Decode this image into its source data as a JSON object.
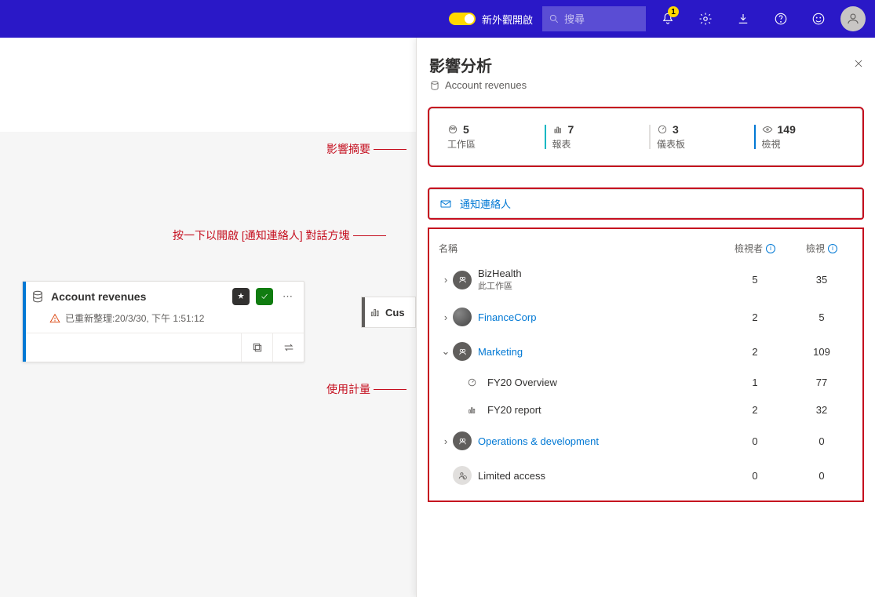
{
  "topnav": {
    "toggle_label": "新外觀開啟",
    "search_placeholder": "搜尋",
    "notification_count": "1"
  },
  "canvas": {
    "node1": {
      "title": "Account revenues",
      "refreshed": "已重新整理:20/3/30, 下午 1:51:12"
    },
    "node2_label": "Cus"
  },
  "callouts": {
    "summary": "影響摘要",
    "notify": "按一下以開啟 [通知連絡人] 對話方塊",
    "usage": "使用計量"
  },
  "panel": {
    "title": "影響分析",
    "subtitle": "Account revenues",
    "summary": [
      {
        "count": "5",
        "label": "工作區"
      },
      {
        "count": "7",
        "label": "報表"
      },
      {
        "count": "3",
        "label": "儀表板"
      },
      {
        "count": "149",
        "label": "檢視"
      }
    ],
    "notify_label": "通知連絡人",
    "table": {
      "head_name": "名稱",
      "head_viewers": "檢視者",
      "head_views": "檢視",
      "rows": [
        {
          "name": "BizHealth",
          "sub": "此工作區",
          "link": false,
          "viewers": "5",
          "views": "35",
          "icon": "workspace"
        },
        {
          "name": "FinanceCorp",
          "link": true,
          "viewers": "2",
          "views": "5",
          "icon": "image"
        },
        {
          "name": "Marketing",
          "link": true,
          "viewers": "2",
          "views": "109",
          "icon": "workspace",
          "expanded": true,
          "children": [
            {
              "name": "FY20 Overview",
              "icon": "dashboard",
              "viewers": "1",
              "views": "77"
            },
            {
              "name": "FY20 report",
              "icon": "report",
              "viewers": "2",
              "views": "32"
            }
          ]
        },
        {
          "name": "Operations & development",
          "link": true,
          "viewers": "0",
          "views": "0",
          "icon": "workspace"
        },
        {
          "name": "Limited access",
          "link": false,
          "viewers": "0",
          "views": "0",
          "icon": "limited"
        }
      ]
    }
  }
}
